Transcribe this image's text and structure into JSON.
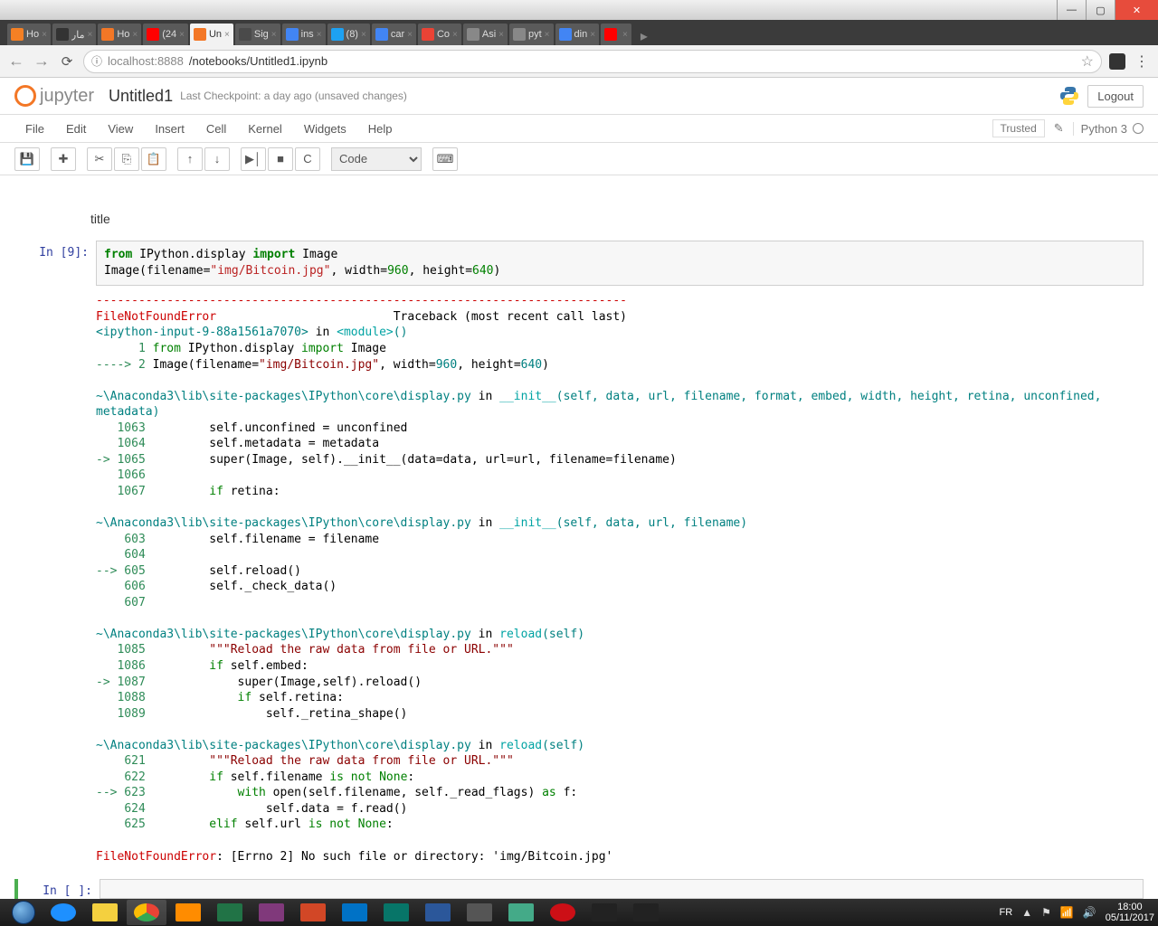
{
  "window": {
    "minimize": "—",
    "maximize": "▢",
    "close": "✕"
  },
  "tabs": [
    {
      "label": "Ho",
      "favBg": "#f48024"
    },
    {
      "label": "مار",
      "favBg": "#333"
    },
    {
      "label": "Ho",
      "favBg": "#f37726"
    },
    {
      "label": "(24",
      "favBg": "#ff0000"
    },
    {
      "label": "Un",
      "favBg": "#f37726",
      "active": true
    },
    {
      "label": "Sig",
      "favBg": "#4a4a4a"
    },
    {
      "label": "ins",
      "favBg": "#4285f4"
    },
    {
      "label": "(8)",
      "favBg": "#1da1f2"
    },
    {
      "label": "car",
      "favBg": "#4285f4"
    },
    {
      "label": "Co",
      "favBg": "#ea4335"
    },
    {
      "label": "Asi",
      "favBg": "#888"
    },
    {
      "label": "pyt",
      "favBg": "#888"
    },
    {
      "label": "din",
      "favBg": "#4285f4"
    },
    {
      "label": "",
      "favBg": "#ff0000"
    }
  ],
  "url": {
    "secure": "ⓘ",
    "host": "localhost",
    "port": ":8888",
    "path": "/notebooks/Untitled1.ipynb"
  },
  "header": {
    "brand": "jupyter",
    "title": "Untitled1",
    "checkpoint": "Last Checkpoint: a day ago (unsaved changes)",
    "logout": "Logout"
  },
  "menu": {
    "items": [
      "File",
      "Edit",
      "View",
      "Insert",
      "Cell",
      "Kernel",
      "Widgets",
      "Help"
    ],
    "trusted": "Trusted",
    "kernel": "Python 3"
  },
  "toolbar": {
    "save": "💾",
    "add": "✚",
    "cut": "✂",
    "copy": "⎘",
    "paste": "📋",
    "up": "↑",
    "down": "↓",
    "run": "▶│",
    "stop": "■",
    "restart": "C",
    "celltype": "Code",
    "cmd": "⌨"
  },
  "notebook": {
    "titleCell": "title",
    "promptIn": "In [9]:",
    "promptEmpty": "In [ ]:",
    "code": {
      "l1_from": "from",
      "l1_mod": "IPython.display",
      "l1_imp": "import",
      "l1_img": "Image",
      "l2_pre": "Image(filename=",
      "l2_str": "\"img/Bitcoin.jpg\"",
      "l2_mid": ", width=",
      "l2_n1": "960",
      "l2_mid2": ", height=",
      "l2_n2": "640",
      "l2_end": ")"
    },
    "err": {
      "dash": "---------------------------------------------------------------------------",
      "name": "FileNotFoundError",
      "tb": "                         Traceback (most recent call last)",
      "ipy": "<ipython-input-9-88a1561a7070>",
      "inword": " in ",
      "mod": "<module>",
      "paren": "()",
      "l1_pre": "      1 ",
      "l1_from": "from",
      "l1_mod": " IPython.display ",
      "l1_imp": "import",
      "l1_img": " Image",
      "l2_arrow": "----> 2 ",
      "l2_pre": "Image(filename=",
      "l2_str": "\"img/Bitcoin.jpg\"",
      "l2_mid": ", width=",
      "l2_n1": "960",
      "l2_mid2": ", height=",
      "l2_n2": "640",
      "l2_end": ")",
      "path1": "~\\Anaconda3\\lib\\site-packages\\IPython\\core\\display.py",
      "in1": " in ",
      "fn1": "__init__",
      "sig1": "(self, data, url, filename, format, embed, width, height, retina, unconfined, metadata)",
      "b1_1063": "   1063 ",
      "b1_1063t": "        self.unconfined = unconfined",
      "b1_1064": "   1064 ",
      "b1_1064t": "        self.metadata = metadata",
      "b1_1065a": "-> 1065 ",
      "b1_1065t": "        super(Image, self).__init__(data=data, url=url, filename=filename)",
      "b1_1066": "   1066 ",
      "b1_1067": "   1067 ",
      "b1_1067if": "        if",
      "b1_1067t": " retina:",
      "fn2": "__init__",
      "sig2": "(self, data, url, filename)",
      "b2_603": "    603 ",
      "b2_603t": "        self.filename = filename",
      "b2_604": "    604 ",
      "b2_605a": "--> 605 ",
      "b2_605t": "        self.reload()",
      "b2_606": "    606 ",
      "b2_606t": "        self._check_data()",
      "b2_607": "    607 ",
      "fn3": "reload",
      "sig3": "(self)",
      "b3_1085": "   1085 ",
      "b3_1085t": "        \"\"\"Reload the raw data from file or URL.\"\"\"",
      "b3_1086": "   1086 ",
      "b3_1086if": "        if",
      "b3_1086t": " self.embed:",
      "b3_1087a": "-> 1087 ",
      "b3_1087t": "            super(Image,self).reload()",
      "b3_1088": "   1088 ",
      "b3_1088if": "            if",
      "b3_1088t": " self.retina:",
      "b3_1089": "   1089 ",
      "b3_1089t": "                self._retina_shape()",
      "b4_621": "    621 ",
      "b4_621t": "        \"\"\"Reload the raw data from file or URL.\"\"\"",
      "b4_622": "    622 ",
      "b4_622if": "        if",
      "b4_622t": " self.filename ",
      "b4_622is": "is not None",
      "b4_622c": ":",
      "b4_623a": "--> 623 ",
      "b4_623w": "            with",
      "b4_623t": " open(self.filename, self._read_flags) ",
      "b4_623as": "as",
      "b4_623f": " f:",
      "b4_624": "    624 ",
      "b4_624t": "                self.data = f.read()",
      "b4_625": "    625 ",
      "b4_625e": "        elif",
      "b4_625t": " self.url ",
      "b4_625is": "is not None",
      "b4_625c": ":",
      "final": ": [Errno 2] No such file or directory: 'img/Bitcoin.jpg'"
    }
  },
  "tray": {
    "lang": "FR",
    "up": "▲",
    "flag": "⚑",
    "sig": "📶",
    "vol": "🔊",
    "time": "18:00",
    "date": "05/11/2017"
  }
}
